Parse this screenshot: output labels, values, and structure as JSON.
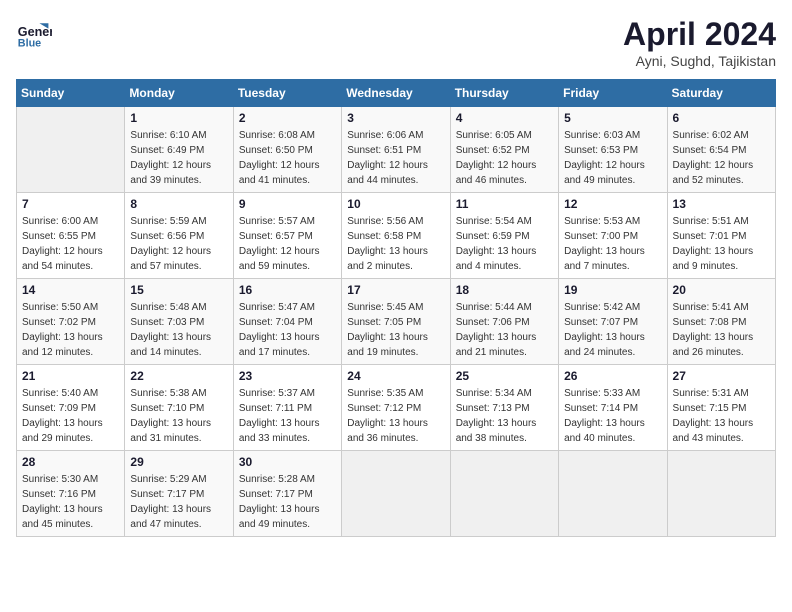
{
  "header": {
    "logo_line1": "General",
    "logo_line2": "Blue",
    "month": "April 2024",
    "location": "Ayni, Sughd, Tajikistan"
  },
  "days_of_week": [
    "Sunday",
    "Monday",
    "Tuesday",
    "Wednesday",
    "Thursday",
    "Friday",
    "Saturday"
  ],
  "weeks": [
    [
      {
        "day": "",
        "sunrise": "",
        "sunset": "",
        "daylight": ""
      },
      {
        "day": "1",
        "sunrise": "Sunrise: 6:10 AM",
        "sunset": "Sunset: 6:49 PM",
        "daylight": "Daylight: 12 hours and 39 minutes."
      },
      {
        "day": "2",
        "sunrise": "Sunrise: 6:08 AM",
        "sunset": "Sunset: 6:50 PM",
        "daylight": "Daylight: 12 hours and 41 minutes."
      },
      {
        "day": "3",
        "sunrise": "Sunrise: 6:06 AM",
        "sunset": "Sunset: 6:51 PM",
        "daylight": "Daylight: 12 hours and 44 minutes."
      },
      {
        "day": "4",
        "sunrise": "Sunrise: 6:05 AM",
        "sunset": "Sunset: 6:52 PM",
        "daylight": "Daylight: 12 hours and 46 minutes."
      },
      {
        "day": "5",
        "sunrise": "Sunrise: 6:03 AM",
        "sunset": "Sunset: 6:53 PM",
        "daylight": "Daylight: 12 hours and 49 minutes."
      },
      {
        "day": "6",
        "sunrise": "Sunrise: 6:02 AM",
        "sunset": "Sunset: 6:54 PM",
        "daylight": "Daylight: 12 hours and 52 minutes."
      }
    ],
    [
      {
        "day": "7",
        "sunrise": "Sunrise: 6:00 AM",
        "sunset": "Sunset: 6:55 PM",
        "daylight": "Daylight: 12 hours and 54 minutes."
      },
      {
        "day": "8",
        "sunrise": "Sunrise: 5:59 AM",
        "sunset": "Sunset: 6:56 PM",
        "daylight": "Daylight: 12 hours and 57 minutes."
      },
      {
        "day": "9",
        "sunrise": "Sunrise: 5:57 AM",
        "sunset": "Sunset: 6:57 PM",
        "daylight": "Daylight: 12 hours and 59 minutes."
      },
      {
        "day": "10",
        "sunrise": "Sunrise: 5:56 AM",
        "sunset": "Sunset: 6:58 PM",
        "daylight": "Daylight: 13 hours and 2 minutes."
      },
      {
        "day": "11",
        "sunrise": "Sunrise: 5:54 AM",
        "sunset": "Sunset: 6:59 PM",
        "daylight": "Daylight: 13 hours and 4 minutes."
      },
      {
        "day": "12",
        "sunrise": "Sunrise: 5:53 AM",
        "sunset": "Sunset: 7:00 PM",
        "daylight": "Daylight: 13 hours and 7 minutes."
      },
      {
        "day": "13",
        "sunrise": "Sunrise: 5:51 AM",
        "sunset": "Sunset: 7:01 PM",
        "daylight": "Daylight: 13 hours and 9 minutes."
      }
    ],
    [
      {
        "day": "14",
        "sunrise": "Sunrise: 5:50 AM",
        "sunset": "Sunset: 7:02 PM",
        "daylight": "Daylight: 13 hours and 12 minutes."
      },
      {
        "day": "15",
        "sunrise": "Sunrise: 5:48 AM",
        "sunset": "Sunset: 7:03 PM",
        "daylight": "Daylight: 13 hours and 14 minutes."
      },
      {
        "day": "16",
        "sunrise": "Sunrise: 5:47 AM",
        "sunset": "Sunset: 7:04 PM",
        "daylight": "Daylight: 13 hours and 17 minutes."
      },
      {
        "day": "17",
        "sunrise": "Sunrise: 5:45 AM",
        "sunset": "Sunset: 7:05 PM",
        "daylight": "Daylight: 13 hours and 19 minutes."
      },
      {
        "day": "18",
        "sunrise": "Sunrise: 5:44 AM",
        "sunset": "Sunset: 7:06 PM",
        "daylight": "Daylight: 13 hours and 21 minutes."
      },
      {
        "day": "19",
        "sunrise": "Sunrise: 5:42 AM",
        "sunset": "Sunset: 7:07 PM",
        "daylight": "Daylight: 13 hours and 24 minutes."
      },
      {
        "day": "20",
        "sunrise": "Sunrise: 5:41 AM",
        "sunset": "Sunset: 7:08 PM",
        "daylight": "Daylight: 13 hours and 26 minutes."
      }
    ],
    [
      {
        "day": "21",
        "sunrise": "Sunrise: 5:40 AM",
        "sunset": "Sunset: 7:09 PM",
        "daylight": "Daylight: 13 hours and 29 minutes."
      },
      {
        "day": "22",
        "sunrise": "Sunrise: 5:38 AM",
        "sunset": "Sunset: 7:10 PM",
        "daylight": "Daylight: 13 hours and 31 minutes."
      },
      {
        "day": "23",
        "sunrise": "Sunrise: 5:37 AM",
        "sunset": "Sunset: 7:11 PM",
        "daylight": "Daylight: 13 hours and 33 minutes."
      },
      {
        "day": "24",
        "sunrise": "Sunrise: 5:35 AM",
        "sunset": "Sunset: 7:12 PM",
        "daylight": "Daylight: 13 hours and 36 minutes."
      },
      {
        "day": "25",
        "sunrise": "Sunrise: 5:34 AM",
        "sunset": "Sunset: 7:13 PM",
        "daylight": "Daylight: 13 hours and 38 minutes."
      },
      {
        "day": "26",
        "sunrise": "Sunrise: 5:33 AM",
        "sunset": "Sunset: 7:14 PM",
        "daylight": "Daylight: 13 hours and 40 minutes."
      },
      {
        "day": "27",
        "sunrise": "Sunrise: 5:31 AM",
        "sunset": "Sunset: 7:15 PM",
        "daylight": "Daylight: 13 hours and 43 minutes."
      }
    ],
    [
      {
        "day": "28",
        "sunrise": "Sunrise: 5:30 AM",
        "sunset": "Sunset: 7:16 PM",
        "daylight": "Daylight: 13 hours and 45 minutes."
      },
      {
        "day": "29",
        "sunrise": "Sunrise: 5:29 AM",
        "sunset": "Sunset: 7:17 PM",
        "daylight": "Daylight: 13 hours and 47 minutes."
      },
      {
        "day": "30",
        "sunrise": "Sunrise: 5:28 AM",
        "sunset": "Sunset: 7:17 PM",
        "daylight": "Daylight: 13 hours and 49 minutes."
      },
      {
        "day": "",
        "sunrise": "",
        "sunset": "",
        "daylight": ""
      },
      {
        "day": "",
        "sunrise": "",
        "sunset": "",
        "daylight": ""
      },
      {
        "day": "",
        "sunrise": "",
        "sunset": "",
        "daylight": ""
      },
      {
        "day": "",
        "sunrise": "",
        "sunset": "",
        "daylight": ""
      }
    ]
  ]
}
